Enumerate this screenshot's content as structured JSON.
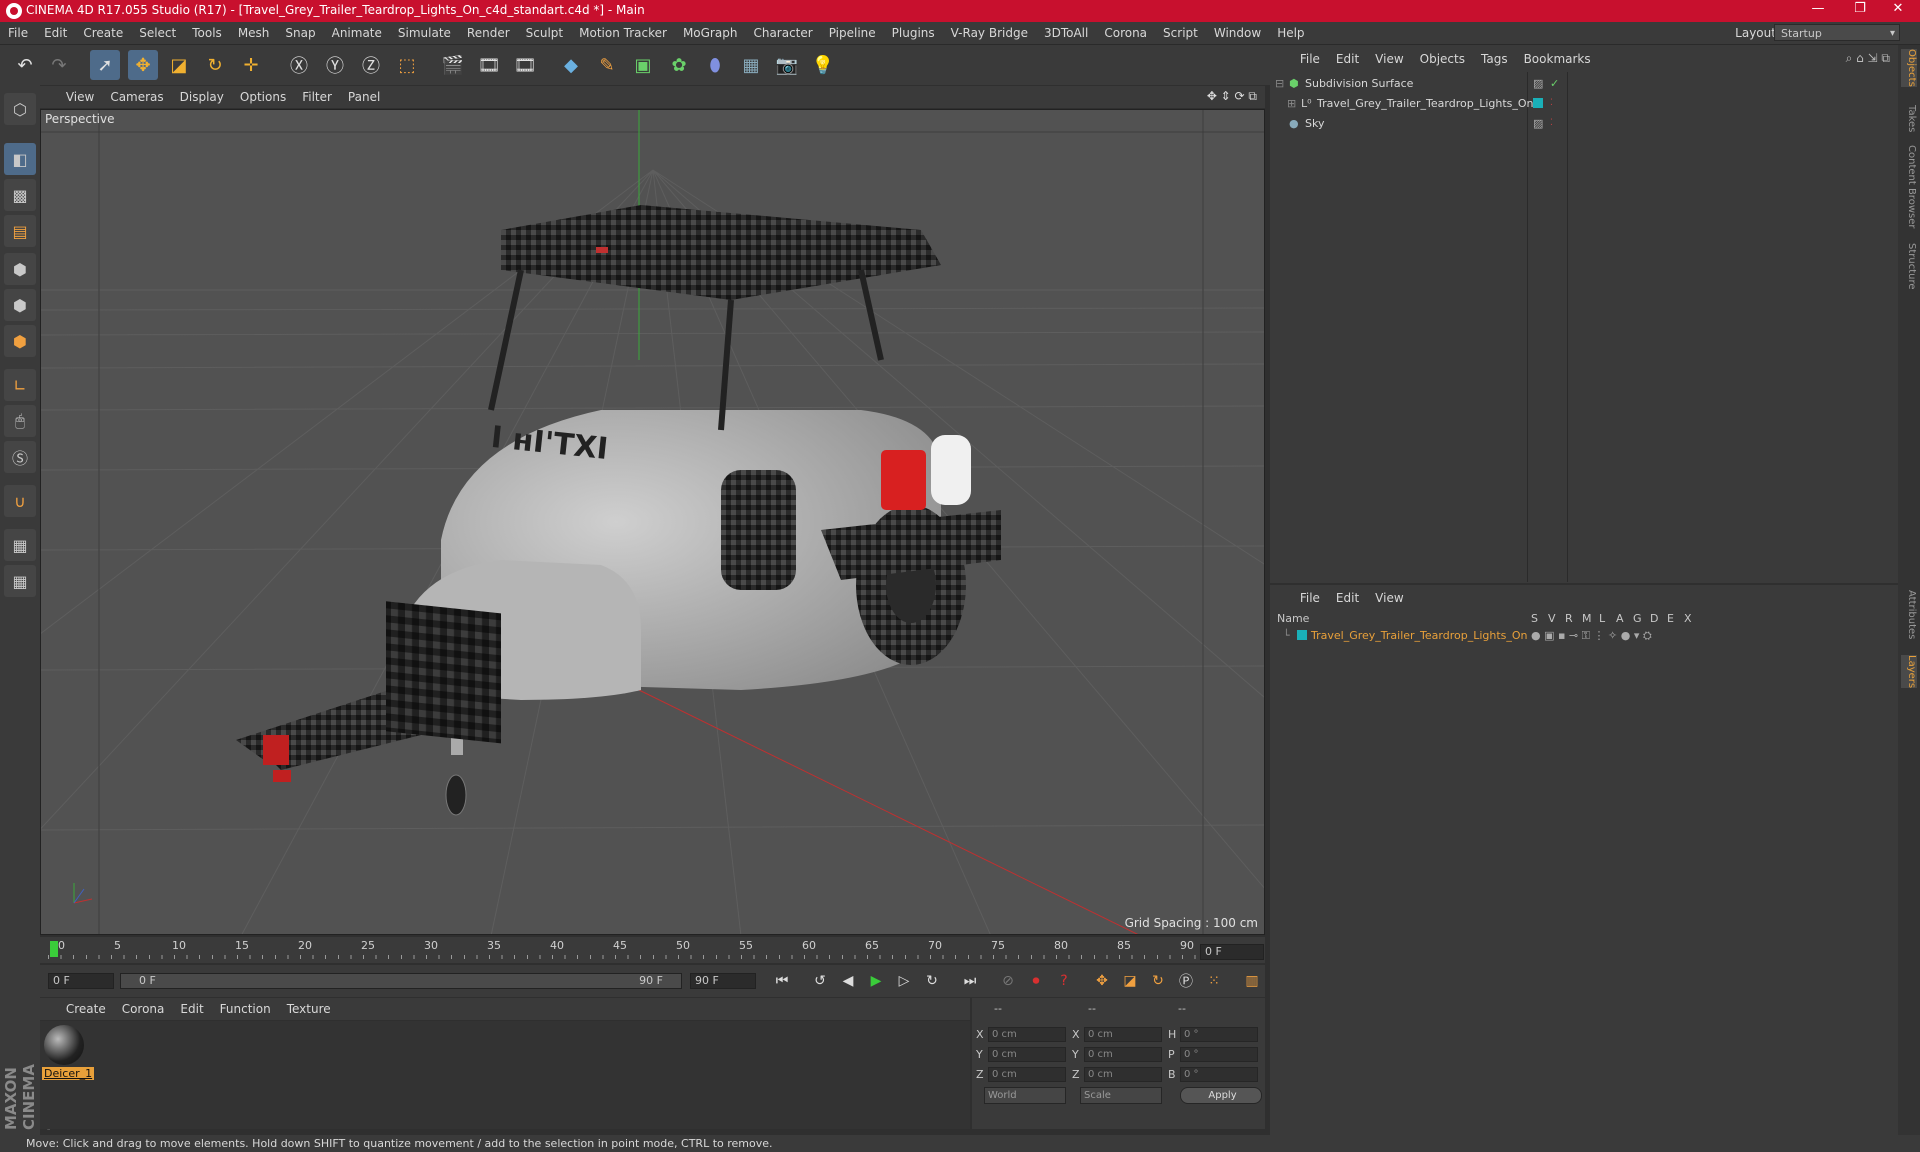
{
  "window": {
    "title": "CINEMA 4D R17.055 Studio (R17) - [Travel_Grey_Trailer_Teardrop_Lights_On_c4d_standart.c4d *] - Main",
    "minimize": "—",
    "restore": "❐",
    "close": "✕"
  },
  "menu": [
    "File",
    "Edit",
    "Create",
    "Select",
    "Tools",
    "Mesh",
    "Snap",
    "Animate",
    "Simulate",
    "Render",
    "Sculpt",
    "Motion Tracker",
    "MoGraph",
    "Character",
    "Pipeline",
    "Plugins",
    "V-Ray Bridge",
    "3DToAll",
    "Corona",
    "Script",
    "Window",
    "Help"
  ],
  "layout": {
    "label": "Layout:",
    "value": "Startup"
  },
  "viewport": {
    "menu": [
      "View",
      "Cameras",
      "Display",
      "Options",
      "Filter",
      "Panel"
    ],
    "label": "Perspective",
    "grid_spacing": "Grid Spacing : 100 cm"
  },
  "timeline": {
    "ticks": [
      "0",
      "5",
      "10",
      "15",
      "20",
      "25",
      "30",
      "35",
      "40",
      "45",
      "50",
      "55",
      "60",
      "65",
      "70",
      "75",
      "80",
      "85",
      "90"
    ],
    "frame_end": "0 F",
    "start_field": "0 F",
    "slider_left": "0 F",
    "slider_right": "90 F",
    "end_field": "90 F"
  },
  "material": {
    "menu": [
      "Create",
      "Corona",
      "Edit",
      "Function",
      "Texture"
    ],
    "item_label": "Deicer_1"
  },
  "coordinates": {
    "header1": "--",
    "header2": "--",
    "header3": "--",
    "rows": [
      {
        "a": "X",
        "v1": "0 cm",
        "b": "X",
        "v2": "0 cm",
        "c": "H",
        "v3": "0 °"
      },
      {
        "a": "Y",
        "v1": "0 cm",
        "b": "Y",
        "v2": "0 cm",
        "c": "P",
        "v3": "0 °"
      },
      {
        "a": "Z",
        "v1": "0 cm",
        "b": "Z",
        "v2": "0 cm",
        "c": "B",
        "v3": "0 °"
      }
    ],
    "world": "World",
    "scale": "Scale",
    "apply": "Apply"
  },
  "objects": {
    "menu": [
      "File",
      "Edit",
      "View",
      "Objects",
      "Tags",
      "Bookmarks"
    ],
    "items": [
      {
        "name": "Subdivision Surface"
      },
      {
        "name": "Travel_Grey_Trailer_Teardrop_Lights_On"
      },
      {
        "name": "Sky"
      }
    ]
  },
  "layers": {
    "menu": [
      "File",
      "Edit",
      "View"
    ],
    "header_name": "Name",
    "header_cols": [
      "S",
      "V",
      "R",
      "M",
      "L",
      "A",
      "G",
      "D",
      "E",
      "X"
    ],
    "items": [
      {
        "name": "Travel_Grey_Trailer_Teardrop_Lights_On"
      }
    ]
  },
  "side_tabs": [
    "Objects",
    "Takes",
    "Content Browser",
    "Structure",
    "Attributes",
    "Layers"
  ],
  "status": "Move: Click and drag to move elements. Hold down SHIFT to quantize movement / add to the selection in point mode, CTRL to remove.",
  "brand": "MAXON CINEMA 4D",
  "colors": {
    "titlebar": "#c8102e",
    "accent": "#e8a03a",
    "selected": "#4e6b8a"
  }
}
